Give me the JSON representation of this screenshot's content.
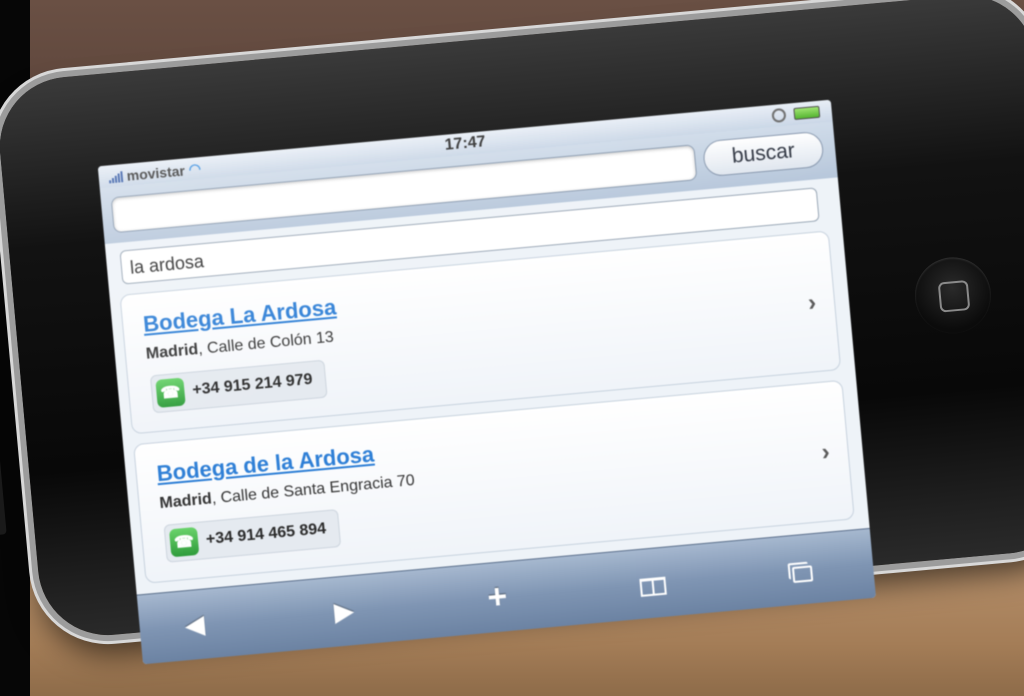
{
  "status_bar": {
    "carrier": "movistar",
    "time": "17:47",
    "battery_color": "#4fb22a"
  },
  "search": {
    "url_value": "",
    "button_label": "buscar"
  },
  "query": {
    "value": "la ardosa"
  },
  "results": [
    {
      "title": "Bodega La Ardosa",
      "city": "Madrid",
      "street": ", Calle de Colón 13",
      "phone": "+34 915 214 979"
    },
    {
      "title": "Bodega de la Ardosa",
      "city": "Madrid",
      "street": ", Calle de Santa Engracia 70",
      "phone": "+34 914 465 894"
    }
  ],
  "toolbar": {
    "back_icon": "back-arrow-icon",
    "forward_icon": "forward-arrow-icon",
    "add_icon": "plus-icon",
    "bookmarks_icon": "bookmarks-icon",
    "pages_icon": "pages-icon"
  },
  "colors": {
    "link": "#2e7fd6",
    "call_button": "#2f9c3b",
    "toolbar": "#7f95b3"
  }
}
